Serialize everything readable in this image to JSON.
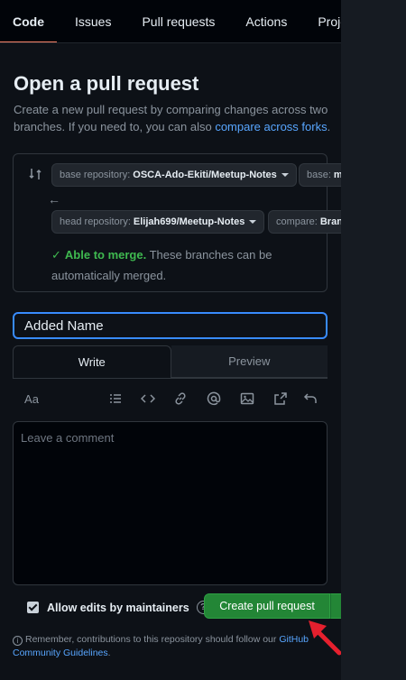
{
  "nav": {
    "tabs": [
      "Code",
      "Issues",
      "Pull requests",
      "Actions",
      "Projects"
    ],
    "active": "Code"
  },
  "page": {
    "title": "Open a pull request",
    "description": "Create a new pull request by comparing changes across two branches. If you need to, you can also",
    "compare_forks_link": "compare across forks",
    "description_end": "."
  },
  "compare": {
    "base_repo_label": "base repository:",
    "base_repo_value": "OSCA-Ado-Ekiti/Meetup-Notes",
    "base_label": "base:",
    "base_value": "main",
    "head_repo_label": "head repository:",
    "head_repo_value": "Elijah699/Meetup-Notes",
    "compare_label": "compare:",
    "compare_value": "Branch-Name",
    "merge_status": "Able to merge.",
    "merge_detail": "These branches can be automatically merged."
  },
  "form": {
    "title_value": "Added Name",
    "write_tab": "Write",
    "preview_tab": "Preview",
    "heading_icon_label": "Aa",
    "comment_placeholder": "Leave a comment",
    "allow_edits_label": "Allow edits by maintainers",
    "allow_edits_checked": true,
    "help_glyph": "?",
    "create_button": "Create pull request"
  },
  "footer": {
    "note": "Remember, contributions to this repository should follow our",
    "guidelines_link": "GitHub Community Guidelines",
    "note_end": "."
  },
  "colors": {
    "accent_link": "#58a6ff",
    "success": "#3fb950",
    "primary_button": "#238636",
    "focus_border": "#388bfd",
    "annotation_arrow": "#e5202e"
  }
}
